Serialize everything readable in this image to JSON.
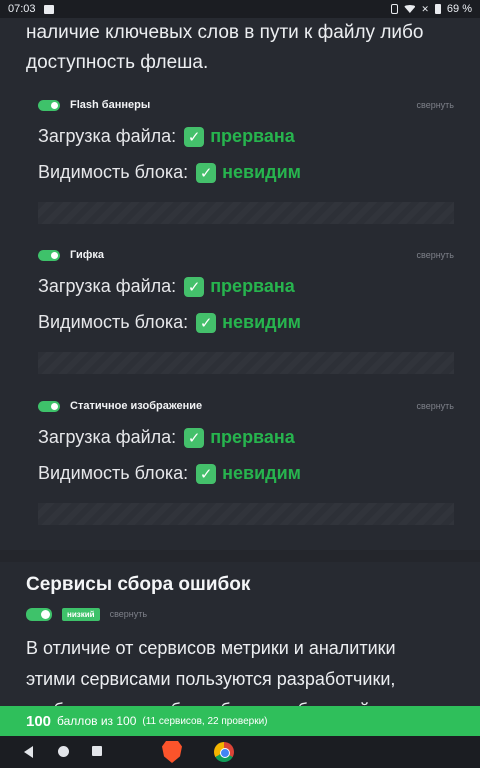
{
  "status_bar": {
    "time": "07:03",
    "battery": "69 %"
  },
  "intro_text": "наличие ключевых слов в пути к файлу либо доступность флеша.",
  "labels": {
    "load": "Загрузка файла:",
    "visibility": "Видимость блока:",
    "collapse": "свернуть"
  },
  "tests": [
    {
      "title": "Flash баннеры",
      "load_status": "прервана",
      "visibility_status": "невидим"
    },
    {
      "title": "Гифка",
      "load_status": "прервана",
      "visibility_status": "невидим"
    },
    {
      "title": "Статичное изображение",
      "load_status": "прервана",
      "visibility_status": "невидим"
    }
  ],
  "section": {
    "title": "Сервисы сбора ошибок",
    "badge": "низкий",
    "text": "В отличие от сервисов метрики и аналитики этими сервисами пользуются разработчики, чтобы узнавать об ошибках в работе сайтов и"
  },
  "score": {
    "value": "100",
    "of": "баллов из 100",
    "detail": "(11 сервисов, 22 проверки)"
  },
  "colors": {
    "accent": "#2fbf5b",
    "background": "#272a31",
    "status_ok": "#27b44e"
  }
}
